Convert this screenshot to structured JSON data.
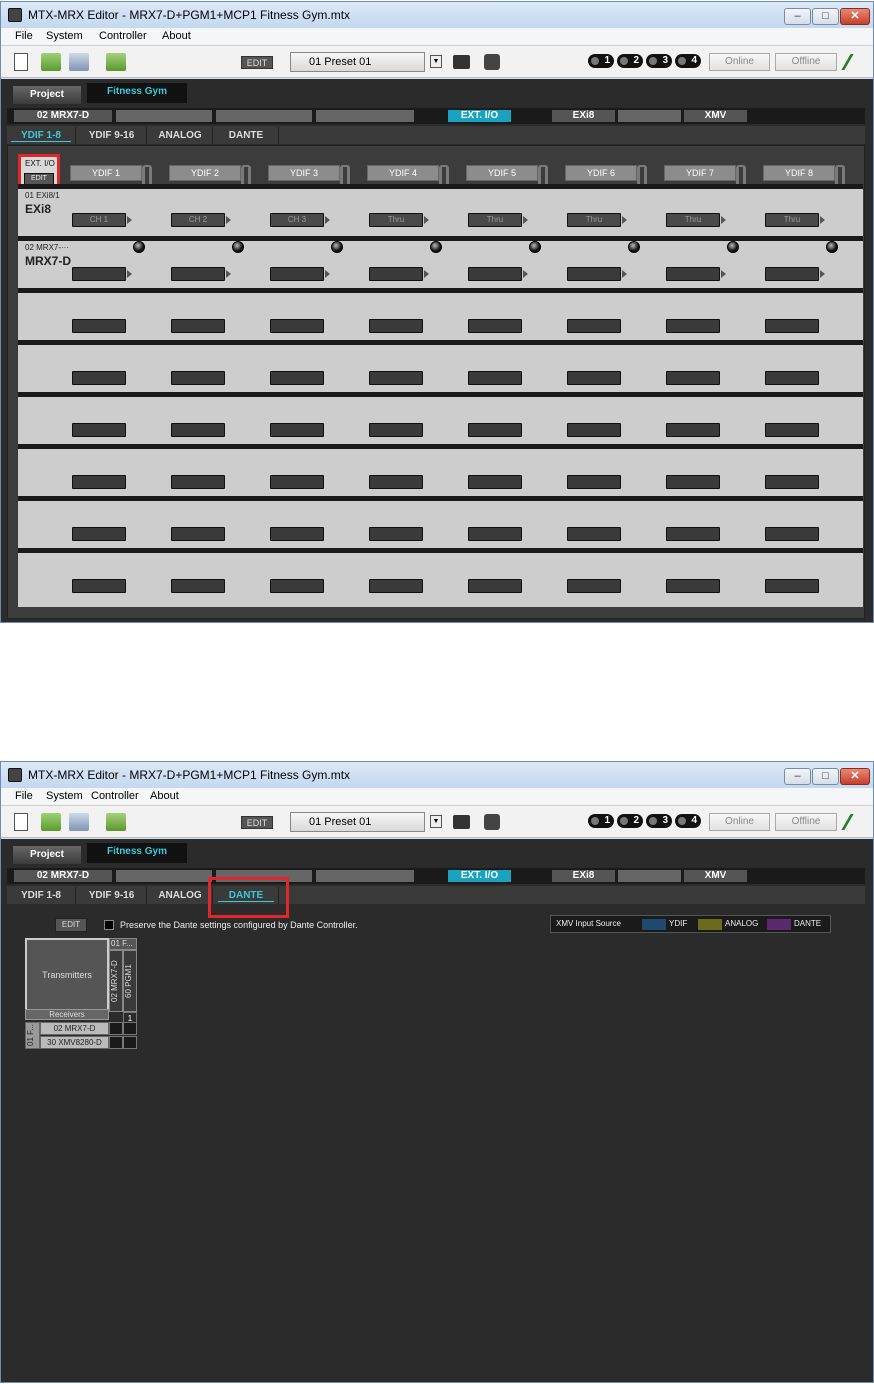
{
  "window": {
    "title": "MTX-MRX Editor - MRX7-D+PGM1+MCP1 Fitness Gym.mtx",
    "min": "–",
    "max": "□",
    "close": "✕"
  },
  "menu": [
    "File",
    "System",
    "Controller",
    "About"
  ],
  "toolbar": {
    "edit_label": "EDIT",
    "preset": "01 Preset 01",
    "scenes": [
      "1",
      "2",
      "3",
      "4"
    ],
    "online": "Online",
    "offline": "Offline"
  },
  "project_tabs": [
    "Project",
    "Fitness Gym"
  ],
  "device_slots": [
    "02 MRX7-D",
    "",
    "",
    "",
    "EXT. I/O",
    "EXi8",
    "",
    "XMV"
  ],
  "screen1": {
    "sub_tabs": [
      "YDIF 1-8",
      "YDIF 9-16",
      "ANALOG",
      "DANTE"
    ],
    "active_sub_tab": "YDIF 1-8",
    "ext_io_label": "EXT. I/O",
    "ext_io_edit": "EDIT",
    "columns": [
      "YDIF 1",
      "YDIF 2",
      "YDIF 3",
      "YDIF 4",
      "YDIF 5",
      "YDIF 6",
      "YDIF 7",
      "YDIF 8"
    ],
    "rows": [
      {
        "id": "01 EXi8/1",
        "name": "EXi8",
        "cells": [
          "CH 1",
          "CH 2",
          "CH 3",
          "Thru",
          "Thru",
          "Thru",
          "Thru",
          "Thru"
        ]
      },
      {
        "id": "02 MRX7-···",
        "name": "MRX7-D",
        "cells": [
          "",
          "",
          "",
          "",
          "",
          "",
          "",
          ""
        ]
      }
    ],
    "empty_rows": 6
  },
  "screen2": {
    "sub_tabs": [
      "YDIF 1-8",
      "YDIF 9-16",
      "ANALOG",
      "DANTE"
    ],
    "active_sub_tab": "DANTE",
    "edit_label": "EDIT",
    "preserve_label": "Preserve the Dante settings configured by Dante Controller.",
    "legend_title": "XMV Input Source",
    "legend": [
      {
        "label": "YDIF",
        "color": "#1f4a6e"
      },
      {
        "label": "ANALOG",
        "color": "#6b6b1e"
      },
      {
        "label": "DANTE",
        "color": "#5a2a6e"
      }
    ],
    "transmitters_label": "Transmitters",
    "tx_top": "01 F...",
    "tx_columns": [
      "02 MRX7-D",
      "60 PGM1"
    ],
    "tx_number": "1",
    "receivers_label": "Receivers",
    "rx_side": "01 F...",
    "rx_rows": [
      "02 MRX7-D",
      "30 XMV8280-D"
    ]
  },
  "colors": {
    "accent": "#3fc9d8",
    "highlight": "#e0272c",
    "active_slot": "#19a3c0"
  }
}
